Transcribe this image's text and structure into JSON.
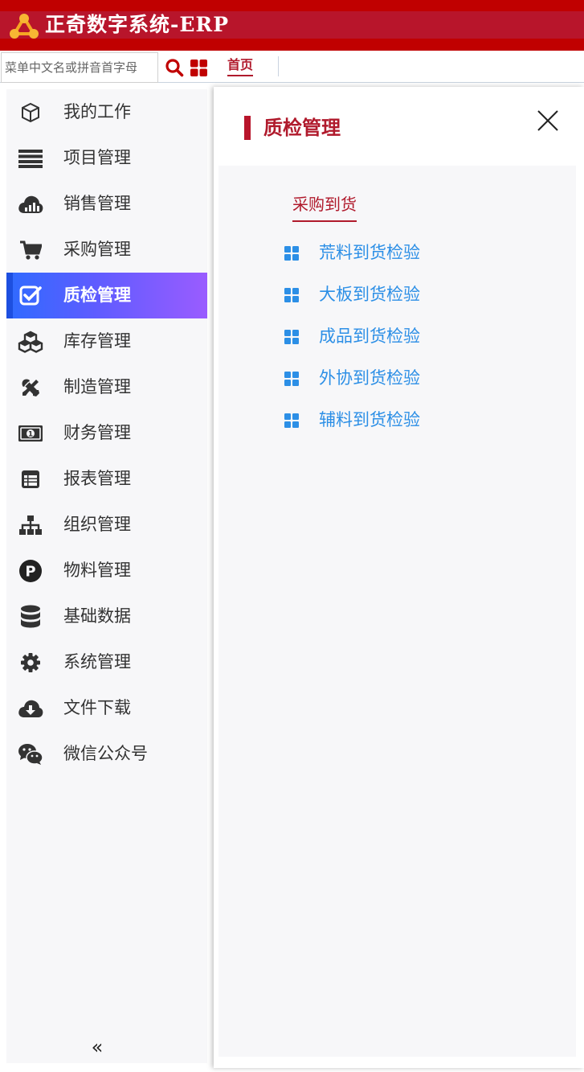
{
  "header": {
    "title": "正奇数字系统-ERP",
    "brand_color": "#c00000",
    "band_color": "#b8152b"
  },
  "toolbar": {
    "search_placeholder": "菜单中文名或拼音首字母",
    "home_tab": "首页"
  },
  "sidebar": {
    "active_index": 4,
    "items": [
      {
        "label": "我的工作",
        "icon": "cube-icon"
      },
      {
        "label": "项目管理",
        "icon": "list-icon"
      },
      {
        "label": "销售管理",
        "icon": "cloud-chart-icon"
      },
      {
        "label": "采购管理",
        "icon": "cart-icon"
      },
      {
        "label": "质检管理",
        "icon": "checkbox-icon"
      },
      {
        "label": "库存管理",
        "icon": "boxes-icon"
      },
      {
        "label": "制造管理",
        "icon": "tools-icon"
      },
      {
        "label": "财务管理",
        "icon": "money-icon"
      },
      {
        "label": "报表管理",
        "icon": "report-icon"
      },
      {
        "label": "组织管理",
        "icon": "org-chart-icon"
      },
      {
        "label": "物料管理",
        "icon": "parking-icon"
      },
      {
        "label": "基础数据",
        "icon": "database-icon"
      },
      {
        "label": "系统管理",
        "icon": "gear-icon"
      },
      {
        "label": "文件下载",
        "icon": "cloud-download-icon"
      },
      {
        "label": "微信公众号",
        "icon": "wechat-icon"
      }
    ],
    "collapse_label": "«"
  },
  "panel": {
    "title": "质检管理",
    "section_title": "采购到货",
    "items": [
      {
        "label": "荒料到货检验"
      },
      {
        "label": "大板到货检验"
      },
      {
        "label": "成品到货检验"
      },
      {
        "label": "外协到货检验"
      },
      {
        "label": "辅料到货检验"
      }
    ],
    "link_color": "#2c8fe6",
    "accent_color": "#b01a2c"
  }
}
